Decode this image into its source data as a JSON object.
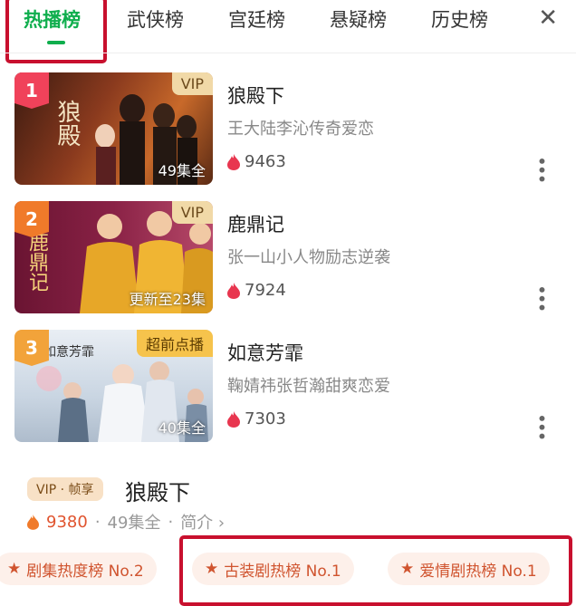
{
  "tabs": [
    "热播榜",
    "武侠榜",
    "宫廷榜",
    "悬疑榜",
    "历史榜"
  ],
  "close_label": "✕",
  "items": [
    {
      "rank": "1",
      "tag": "VIP",
      "episodes": "49集全",
      "title": "狼殿下",
      "desc": "王大陆李沁传奇爱恋",
      "heat": "9463",
      "poster_text": "狼殿"
    },
    {
      "rank": "2",
      "tag": "VIP",
      "episodes": "更新至23集",
      "title": "鹿鼎记",
      "desc": "张一山小人物励志逆袭",
      "heat": "7924",
      "poster_text": "鹿鼎记"
    },
    {
      "rank": "3",
      "tag": "超前点播",
      "episodes": "40集全",
      "title": "如意芳霏",
      "desc": "鞠婧祎张哲瀚甜爽恋爱",
      "heat": "7303",
      "poster_text": "如意芳霏"
    }
  ],
  "detail": {
    "badge": "VIP · 帧享",
    "title": "狼殿下",
    "heat": "9380",
    "episodes": "49集全",
    "intro": "简介",
    "chevron": "›"
  },
  "chips": [
    "剧集热度榜 No.2",
    "古装剧热榜 No.1",
    "爱情剧热榜 No.1"
  ],
  "colors": {
    "accent": "#0fae4d",
    "annotation": "#c8102e",
    "heat": "#e8364f"
  }
}
